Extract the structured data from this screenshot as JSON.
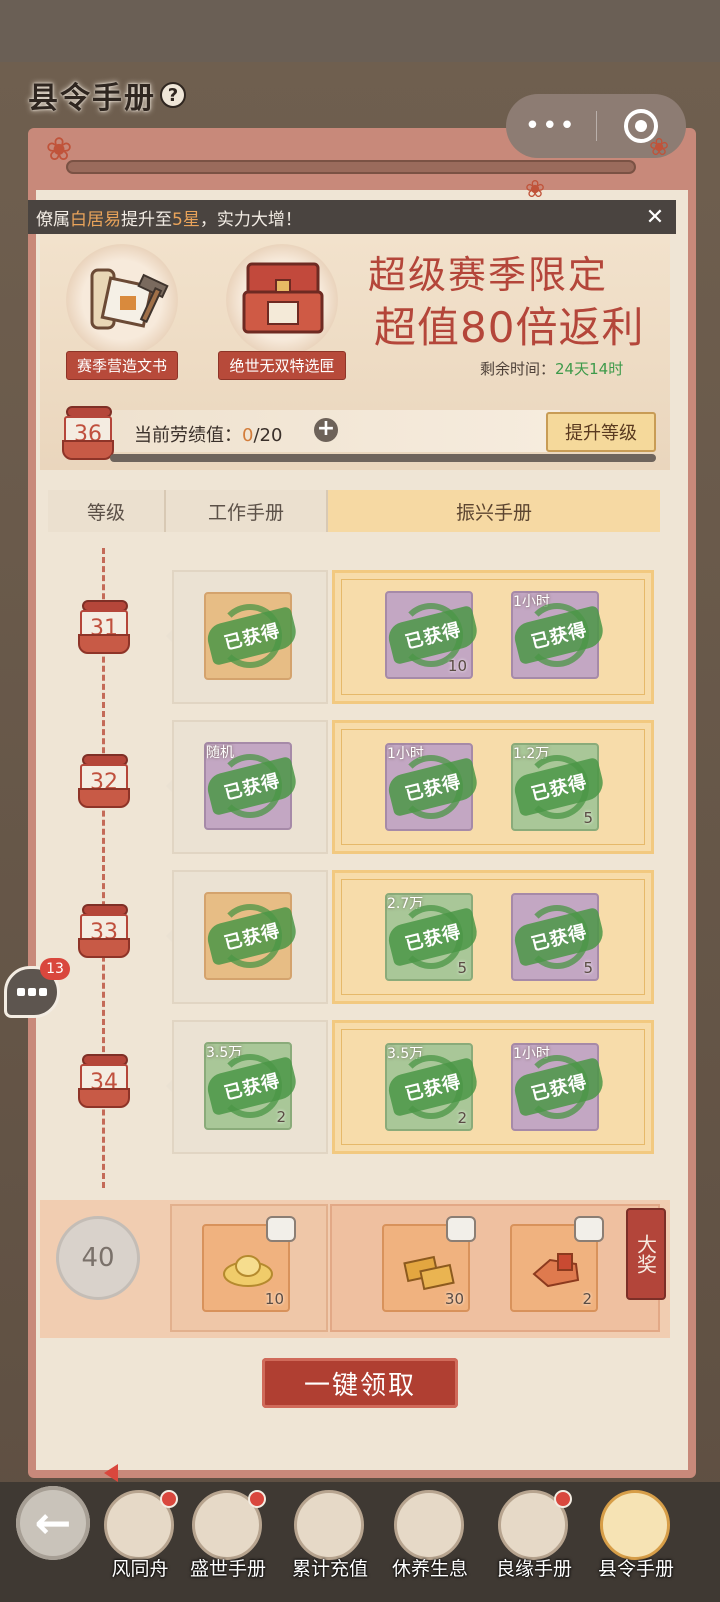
{
  "header": {
    "title": "县令手册",
    "help_icon": "?",
    "more_icon": "•••"
  },
  "notice": {
    "prefix": "僚属",
    "name": "白居易",
    "middle": "提升至",
    "star": "5星",
    "suffix": "，实力大增！",
    "close": "✕"
  },
  "banner": {
    "item1_label": "赛季营造文书",
    "item2_label": "绝世无双特选匣",
    "promo_line1": "超级赛季限定",
    "promo_line2": "超值80倍返利",
    "timer_label": "剩余时间：",
    "timer_value": "24天14时"
  },
  "progress": {
    "level": "36",
    "label": "当前劳绩值：",
    "current": "0",
    "max": "/20",
    "plus": "+",
    "upgrade_button": "提升等级"
  },
  "tabs": {
    "level": "等级",
    "work": "工作手册",
    "revive": "振兴手册"
  },
  "rows": [
    {
      "level": "31",
      "free": {
        "tag": "",
        "count": "",
        "color": "orange"
      },
      "paid": [
        {
          "tag": "",
          "count": "10",
          "color": "purple"
        },
        {
          "tag": "1小时",
          "count": "",
          "color": "purple"
        }
      ]
    },
    {
      "level": "32",
      "free": {
        "tag": "随机",
        "count": "",
        "color": "purple"
      },
      "paid": [
        {
          "tag": "1小时",
          "count": "",
          "color": "purple"
        },
        {
          "tag": "1.2万",
          "count": "5",
          "color": "green"
        }
      ]
    },
    {
      "level": "33",
      "free": {
        "tag": "",
        "count": "",
        "color": "orange"
      },
      "paid": [
        {
          "tag": "2.7万",
          "count": "5",
          "color": "green"
        },
        {
          "tag": "",
          "count": "5",
          "color": "purple"
        }
      ]
    },
    {
      "level": "34",
      "free": {
        "tag": "3.5万",
        "count": "2",
        "color": "green"
      },
      "paid": [
        {
          "tag": "3.5万",
          "count": "2",
          "color": "green"
        },
        {
          "tag": "1小时",
          "count": "",
          "color": "purple"
        }
      ]
    }
  ],
  "obtained_label": "已获得",
  "final_row": {
    "level": "40",
    "free_count": "10",
    "paid1_count": "30",
    "paid2_count": "2",
    "grand_prize": "大奖"
  },
  "claim_all": "一键领取",
  "chat": {
    "count": "13"
  },
  "bottom_nav": [
    {
      "label": "风同舟",
      "dot": true
    },
    {
      "label": "盛世手册",
      "dot": true
    },
    {
      "label": "累计充值",
      "dot": false
    },
    {
      "label": "休养生息",
      "dot": false
    },
    {
      "label": "良缘手册",
      "dot": true
    },
    {
      "label": "县令手册",
      "dot": false,
      "active": true
    }
  ],
  "back_icon": "←"
}
